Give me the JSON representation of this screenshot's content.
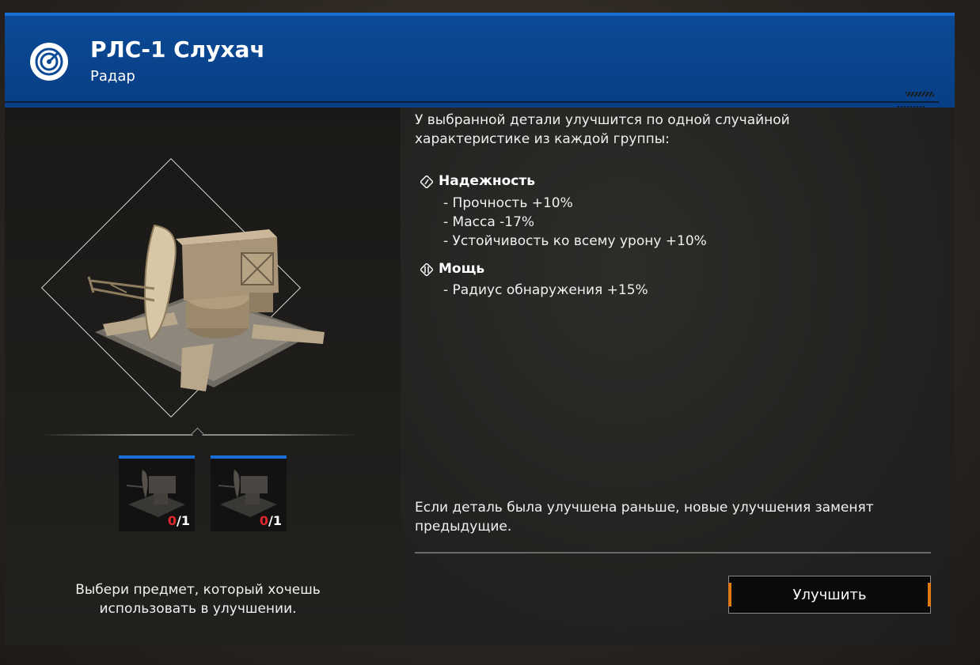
{
  "header": {
    "title": "РЛС-1 Слухач",
    "subtitle": "Радар",
    "icon": "radar-icon"
  },
  "description": {
    "intro": "У выбранной детали улучшится по одной случайной характеристике из каждой группы:",
    "groups": [
      {
        "name": "Надежность",
        "icon": "reliability-icon",
        "stats": [
          "- Прочность +10%",
          "- Масса -17%",
          "- Устойчивость ко всему урону +10%"
        ]
      },
      {
        "name": "Мощь",
        "icon": "power-icon",
        "stats": [
          "- Радиус обнаружения +15%"
        ]
      }
    ],
    "note": "Если деталь была улучшена раньше, новые улучшения заменят предыдущие."
  },
  "slots": [
    {
      "have": "0",
      "need": "/1"
    },
    {
      "have": "0",
      "need": "/1"
    }
  ],
  "left_hint": "Выбери предмет, который хочешь использовать в улучшении.",
  "upgrade_button": "Улучшить",
  "colors": {
    "header_blue": "#0b4a96",
    "accent_blue": "#1a6fd6",
    "count_red": "#e0262a",
    "button_tick": "#e07a10"
  }
}
